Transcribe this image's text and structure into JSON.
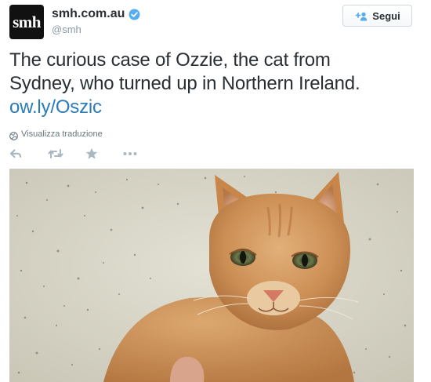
{
  "account": {
    "avatar_text": "smh",
    "display_name": "smh.com.au",
    "username": "@smh",
    "verified_icon": "verified-badge-icon"
  },
  "follow_button": {
    "label": "Segui",
    "icon": "add-user-icon"
  },
  "tweet": {
    "text_line1": "The curious case of Ozzie, the cat from",
    "text_line2": "Sydney, who turned up in Northern Ireland.",
    "link_text": "ow.ly/Oszic"
  },
  "translate": {
    "label": "Visualizza traduzione",
    "icon": "globe-icon"
  },
  "actions": [
    {
      "name": "reply",
      "icon": "reply-icon"
    },
    {
      "name": "retweet",
      "icon": "retweet-icon"
    },
    {
      "name": "favorite",
      "icon": "star-icon"
    },
    {
      "name": "more",
      "icon": "more-icon"
    }
  ],
  "media": {
    "subject": "ginger cat photo"
  },
  "colors": {
    "link": "#2b7bb9",
    "text": "#292f33",
    "muted": "#8899a6",
    "verified": "#55acee",
    "action": "#aab8c2"
  }
}
